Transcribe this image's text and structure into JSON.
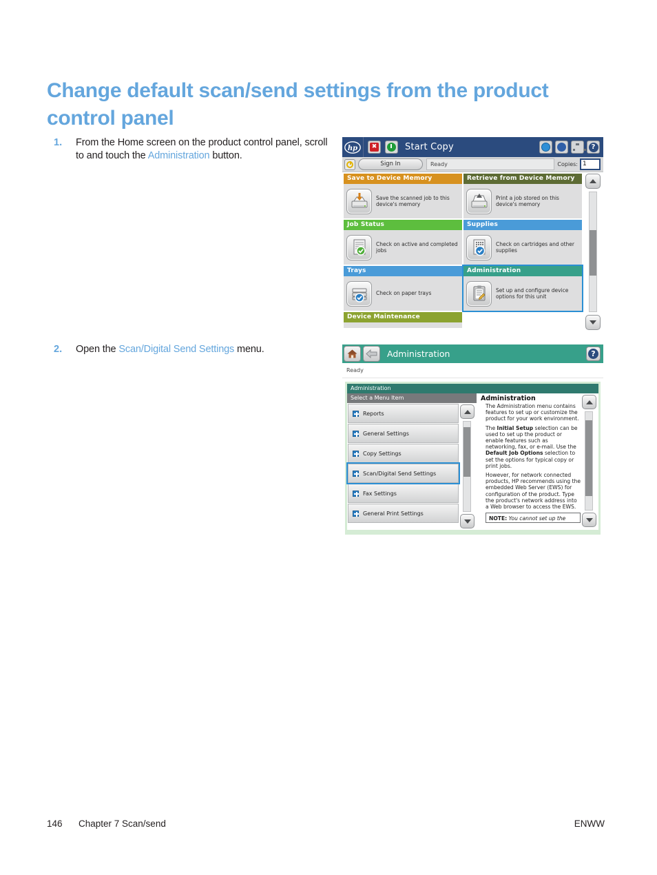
{
  "heading": "Change default scan/send settings from the product control panel",
  "steps": [
    {
      "number": "1.",
      "text_before": "From the Home screen on the product control panel, scroll to and touch the ",
      "accent": "Administration",
      "text_after": " button."
    },
    {
      "number": "2.",
      "text_before": "Open the ",
      "accent": "Scan/Digital Send Settings",
      "text_after": " menu."
    }
  ],
  "screenshot_home": {
    "brand": "hp",
    "title": "Start Copy",
    "icons": {
      "stop": "stop-icon",
      "start": "start-icon",
      "language": "globe-icon",
      "sleep": "moon-icon",
      "network": "network-icon",
      "help": "help-icon",
      "power": "power-icon"
    },
    "sign_in": "Sign In",
    "status": "Ready",
    "copies_label": "Copies:",
    "copies_value": "1",
    "tiles": [
      {
        "title": "Save to Device Memory",
        "desc": "Save the scanned job to this device's memory",
        "color": "#d7911f",
        "color_class": "c-orange",
        "icon": "save-to-memory-icon",
        "selected": false
      },
      {
        "title": "Retrieve from Device Memory",
        "desc": "Print a job stored on this device's memory",
        "color": "#5d6b34",
        "color_class": "c-olive",
        "icon": "retrieve-from-memory-icon",
        "selected": false
      },
      {
        "title": "Job Status",
        "desc": "Check on active and completed jobs",
        "color": "#5dbe3e",
        "color_class": "c-green",
        "icon": "job-status-icon",
        "selected": false
      },
      {
        "title": "Supplies",
        "desc": "Check on cartridges and other supplies",
        "color": "#4a9bd8",
        "color_class": "c-blue",
        "icon": "supplies-icon",
        "selected": false
      },
      {
        "title": "Trays",
        "desc": "Check on paper trays",
        "color": "#4a9bd8",
        "color_class": "c-blue",
        "icon": "trays-icon",
        "selected": false
      },
      {
        "title": "Administration",
        "desc": "Set up and configure device options for this unit",
        "color": "#37a08a",
        "color_class": "c-teal",
        "icon": "administration-icon",
        "selected": true
      },
      {
        "title": "Device Maintenance",
        "desc": "",
        "color": "#8ca330",
        "color_class": "c-lime",
        "icon": "device-maintenance-icon",
        "selected": false
      }
    ]
  },
  "screenshot_admin": {
    "home_icon": "home-icon",
    "back_icon": "back-arrow-icon",
    "title": "Administration",
    "help_icon": "help-icon",
    "status": "Ready",
    "panel_header": "Administration",
    "menu_header": "Select a Menu Item",
    "menu_items": [
      {
        "label": "Reports",
        "selected": false
      },
      {
        "label": "General Settings",
        "selected": false
      },
      {
        "label": "Copy Settings",
        "selected": false
      },
      {
        "label": "Scan/Digital Send Settings",
        "selected": true
      },
      {
        "label": "Fax Settings",
        "selected": false
      },
      {
        "label": "General Print Settings",
        "selected": false
      }
    ],
    "description": {
      "title": "Administration",
      "paragraphs": [
        "The Administration menu contains features to set up or customize the product for your work environment.",
        "The Initial Setup selection can be used to set up the product or enable features such as networking, fax, or e-mail. Use the Default Job Options selection to set the options for typical copy or print jobs.",
        "However, for network connected products, HP recommends using the embedded Web Server (EWS) for configuration of the product. Type the product's network address into a Web browser to access the EWS."
      ],
      "note_label": "NOTE:",
      "note_text": " You cannot set up the"
    }
  },
  "footer": {
    "page": "146",
    "chapter": "Chapter 7   Scan/send",
    "locale": "ENWW"
  },
  "colors": {
    "accent_blue": "#64a6dd",
    "heading_blue": "#64a6dd",
    "topbar_navy": "#2b4b7e",
    "teal": "#37a08a",
    "selection_blue": "#2a8fd4"
  }
}
